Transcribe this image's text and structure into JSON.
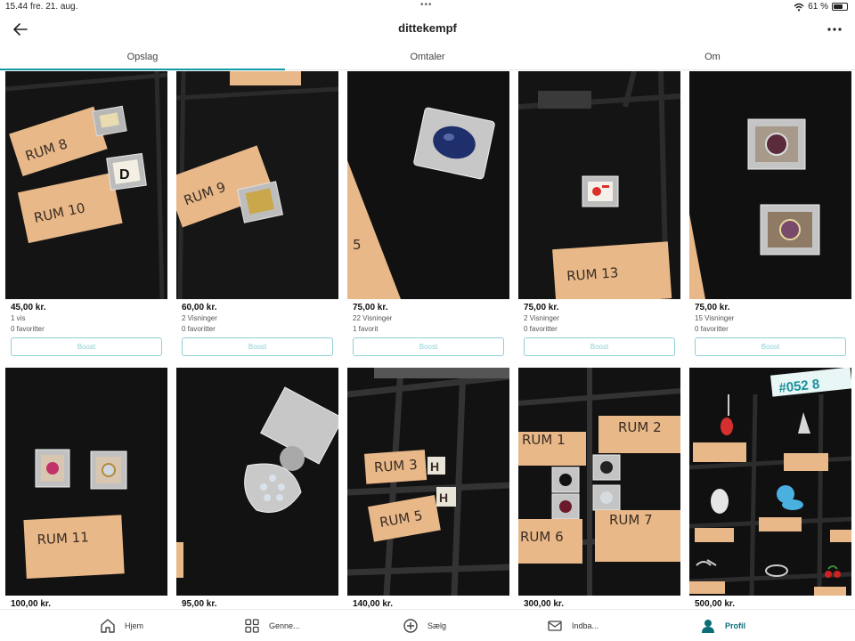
{
  "status": {
    "time": "15.44",
    "date": "fre. 21. aug.",
    "battery": "61 %"
  },
  "header": {
    "title": "dittekempf"
  },
  "tabs": [
    {
      "label": "Opslag",
      "active": true
    },
    {
      "label": "Omtaler",
      "active": false
    },
    {
      "label": "Om",
      "active": false
    }
  ],
  "listings": [
    {
      "price": "45,00 kr.",
      "views": "1 vis",
      "favorites": "0 favoritter",
      "boost": "Boost"
    },
    {
      "price": "60,00 kr.",
      "views": "2 Visninger",
      "favorites": "0 favoritter",
      "boost": "Boost"
    },
    {
      "price": "75,00 kr.",
      "views": "22 Visninger",
      "favorites": "1 favorit",
      "boost": "Boost"
    },
    {
      "price": "75,00 kr.",
      "views": "2 Visninger",
      "favorites": "0 favoritter",
      "boost": "Boost"
    },
    {
      "price": "75,00 kr.",
      "views": "15 Visninger",
      "favorites": "0 favoritter",
      "boost": "Boost"
    },
    {
      "price": "100,00 kr."
    },
    {
      "price": "95,00 kr."
    },
    {
      "price": "140,00 kr."
    },
    {
      "price": "300,00 kr."
    },
    {
      "price": "500,00 kr."
    }
  ],
  "photo_text": {
    "p1a": "RUM 8",
    "p1b": "RUM 10",
    "p1c": "D",
    "p2a": "RUM 9",
    "p3a": "5",
    "p4a": "RUM 13",
    "p6a": "RUM 11",
    "p8a": "RUM 3",
    "p8b": "H",
    "p8c": "RUM 5",
    "p8d": "H",
    "p9a": "RUM 1",
    "p9b": "RUM 2",
    "p9c": "RUM 6",
    "p9d": "RUM 7",
    "p10a": "#052 8"
  },
  "tabbar": [
    {
      "label": "Hjem",
      "icon": "home-icon"
    },
    {
      "label": "Genne...",
      "icon": "grid-icon"
    },
    {
      "label": "Sælg",
      "icon": "plus-circle-icon"
    },
    {
      "label": "Indba...",
      "icon": "mail-icon"
    },
    {
      "label": "Profil",
      "icon": "person-icon",
      "active": true
    }
  ],
  "colors": {
    "accent": "#109aa5",
    "boost_border": "#8fd0d6",
    "active_tab": "#0b6e77"
  }
}
